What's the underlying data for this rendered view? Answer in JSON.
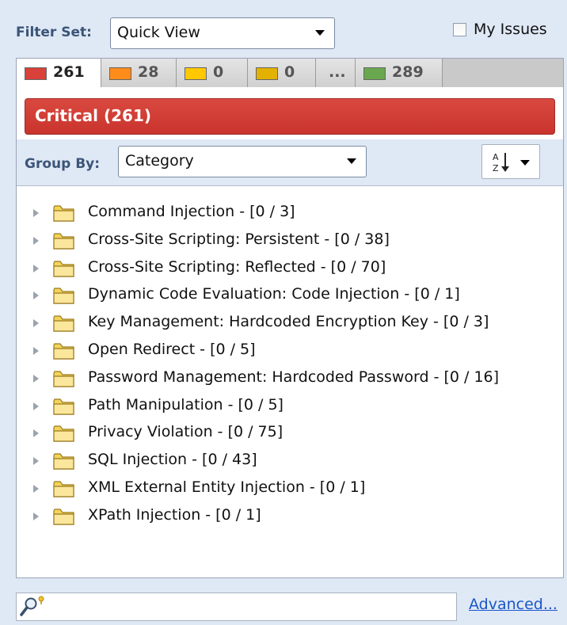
{
  "filter_set": {
    "label": "Filter Set:",
    "value": "Quick View"
  },
  "my_issues": {
    "label": "My Issues",
    "checked": false
  },
  "tabs": [
    {
      "count": "261",
      "color": "#d9413a",
      "active": true
    },
    {
      "count": "28",
      "color": "#ff8c1a",
      "active": false
    },
    {
      "count": "0",
      "color": "#ffc800",
      "active": false
    },
    {
      "count": "0",
      "color": "#e3b200",
      "active": false
    },
    {
      "count": "...",
      "color": null,
      "active": false
    },
    {
      "count": "289",
      "color": "#6aa84f",
      "active": false
    }
  ],
  "severity": {
    "title": "Critical (261)",
    "color": "#c9342d"
  },
  "group_by": {
    "label": "Group By:",
    "value": "Category"
  },
  "sort": {
    "icon": "sort-az-icon"
  },
  "tree": {
    "items": [
      {
        "label": "Command Injection - [0 / 3]"
      },
      {
        "label": "Cross-Site Scripting: Persistent - [0 / 38]"
      },
      {
        "label": "Cross-Site Scripting: Reflected - [0 / 70]"
      },
      {
        "label": "Dynamic Code Evaluation: Code Injection - [0 / 1]"
      },
      {
        "label": "Key Management: Hardcoded Encryption Key - [0 / 3]"
      },
      {
        "label": "Open Redirect - [0 / 5]"
      },
      {
        "label": "Password Management: Hardcoded Password - [0 / 16]"
      },
      {
        "label": "Path Manipulation - [0 / 5]"
      },
      {
        "label": "Privacy Violation - [0 / 75]"
      },
      {
        "label": "SQL Injection - [0 / 43]"
      },
      {
        "label": "XML External Entity Injection - [0 / 1]"
      },
      {
        "label": "XPath Injection - [0 / 1]"
      }
    ]
  },
  "search": {
    "value": "",
    "placeholder": ""
  },
  "advanced": {
    "label": "Advanced..."
  }
}
